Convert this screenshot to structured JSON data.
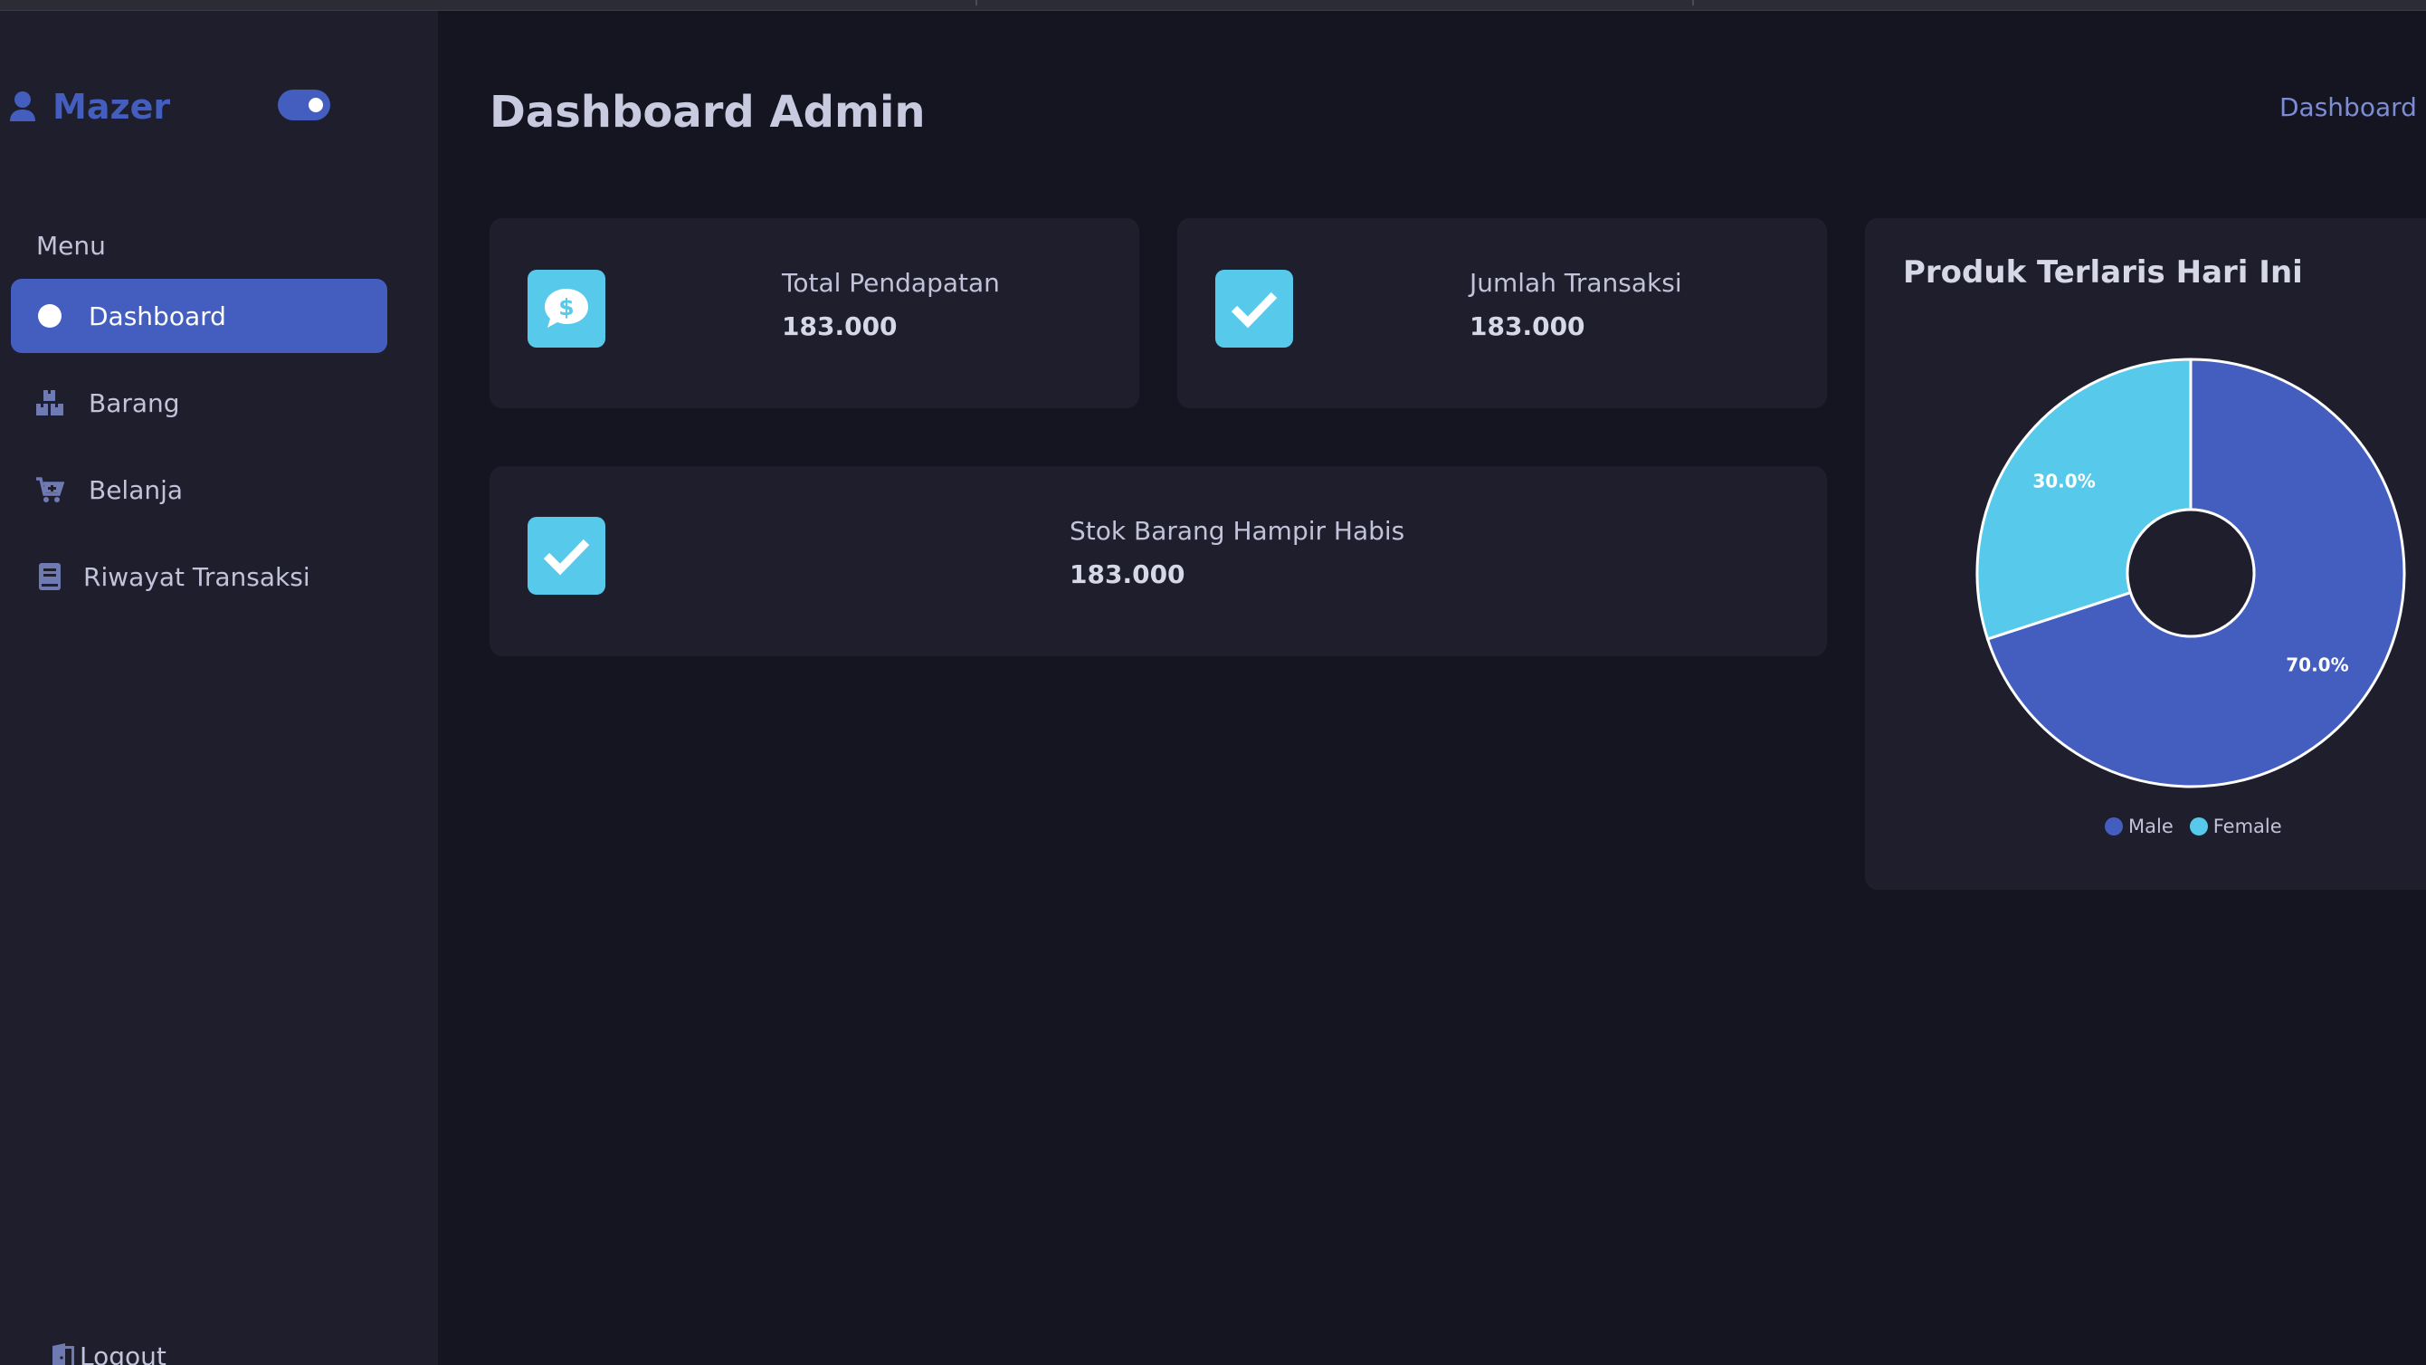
{
  "sidebar": {
    "brand": "Mazer",
    "menu_title": "Menu",
    "items": [
      {
        "label": "Dashboard",
        "icon": "dashboard-circle-icon",
        "active": true
      },
      {
        "label": "Barang",
        "icon": "boxes-icon",
        "active": false
      },
      {
        "label": "Belanja",
        "icon": "cart-icon",
        "active": false
      },
      {
        "label": "Riwayat Transaksi",
        "icon": "book-icon",
        "active": false
      }
    ],
    "logout": "Logout"
  },
  "header": {
    "title": "Dashboard Admin",
    "breadcrumb": [
      "Dashboard"
    ],
    "breadcrumb_sep": "/"
  },
  "stats": [
    {
      "label": "Total Pendapatan",
      "value": "183.000",
      "icon": "money-chat-icon"
    },
    {
      "label": "Jumlah Transaksi",
      "value": "183.000",
      "icon": "check-icon"
    },
    {
      "label": "Stok Barang Hampir Habis",
      "value": "183.000",
      "icon": "check-icon"
    }
  ],
  "chart_card": {
    "title": "Produk Terlaris Hari Ini"
  },
  "chart_data": {
    "type": "pie",
    "title": "Produk Terlaris Hari Ini",
    "categories": [
      "Male",
      "Female"
    ],
    "values": [
      70.0,
      30.0
    ],
    "labels": [
      "70.0%",
      "30.0%"
    ],
    "colors": [
      "#435ebe",
      "#57caeb"
    ],
    "donut": true,
    "legend": "bottom"
  },
  "colors": {
    "accent": "#435ebe",
    "icon_bg": "#57caeb",
    "background": "#151521",
    "panel": "#1e1e2d"
  }
}
